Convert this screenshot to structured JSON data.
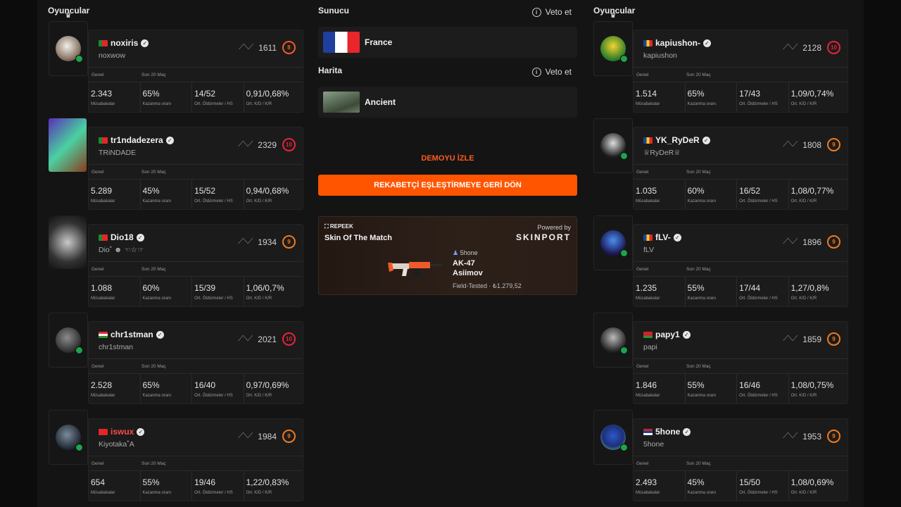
{
  "left_section_title": "Oyuncular",
  "right_section_title": "Oyuncular",
  "labels": {
    "genel": "Genel",
    "son20": "Son 20 Maç",
    "matches": "Müsabakalar",
    "winrate": "Kazanma oranı",
    "kills_hs": "Ort. Öldürmeler / HS",
    "kd_kr": "Ort. K/D / K/R"
  },
  "server": {
    "title": "Sunucu",
    "veto": "Veto et",
    "value": "France"
  },
  "map": {
    "title": "Harita",
    "veto": "Veto et",
    "value": "Ancient"
  },
  "demo_label": "DEMOYU İZLE",
  "back_button": "REKABETÇİ EŞLEŞTİRMEYE GERİ DÖN",
  "ad": {
    "brand": "REPEEK",
    "title": "Skin Of The Match",
    "powered": "Powered by",
    "sponsor": "SKINPORT",
    "seller": "5hone",
    "weapon_line1": "AK-47",
    "weapon_line2": "Asiimov",
    "condition": "Field-Tested · ₺1.279,52"
  },
  "team_left": [
    {
      "nick": "noxiris",
      "sub": "noxwow",
      "elo": "1611",
      "level": "8",
      "matches": "2.343",
      "winrate": "65%",
      "kills": "14/52",
      "kd": "0,91/0,68%",
      "flag": "portugal"
    },
    {
      "nick": "tr1ndadezera",
      "sub": "TRiNDADE",
      "elo": "2329",
      "level": "10",
      "matches": "5.289",
      "winrate": "45%",
      "kills": "15/52",
      "kd": "0,94/0,68%",
      "flag": "portugal"
    },
    {
      "nick": "Dio18",
      "sub": "Dio˚ ☻ ☜☆☞",
      "elo": "1934",
      "level": "9",
      "matches": "1.088",
      "winrate": "60%",
      "kills": "15/39",
      "kd": "1,06/0,7%",
      "flag": "portugal"
    },
    {
      "nick": "chr1stman",
      "sub": "chr1stman",
      "elo": "2021",
      "level": "10",
      "matches": "2.528",
      "winrate": "65%",
      "kills": "16/40",
      "kd": "0,97/0,69%",
      "flag": "hungary"
    },
    {
      "nick": "iswux",
      "sub": "Kiyotaka˚A",
      "elo": "1984",
      "level": "9",
      "matches": "654",
      "winrate": "55%",
      "kills": "19/46",
      "kd": "1,22/0,83%",
      "flag": "turkey"
    }
  ],
  "team_right": [
    {
      "nick": "kapiushon-",
      "sub": "kapiushon",
      "elo": "2128",
      "level": "10",
      "matches": "1.514",
      "winrate": "65%",
      "kills": "17/43",
      "kd": "1,09/0,74%",
      "flag": "romania"
    },
    {
      "nick": "YK_RyDeR",
      "sub": "♕RyDeR♕",
      "elo": "1808",
      "level": "9",
      "matches": "1.035",
      "winrate": "60%",
      "kills": "16/52",
      "kd": "1,08/0,77%",
      "flag": "romania"
    },
    {
      "nick": "fLV-",
      "sub": "fLV",
      "elo": "1896",
      "level": "9",
      "matches": "1.235",
      "winrate": "55%",
      "kills": "17/44",
      "kd": "1,27/0,8%",
      "flag": "romania"
    },
    {
      "nick": "papy1",
      "sub": "papi",
      "elo": "1859",
      "level": "9",
      "matches": "1.846",
      "winrate": "55%",
      "kills": "16/46",
      "kd": "1,08/0,75%",
      "flag": "belarus"
    },
    {
      "nick": "5hone",
      "sub": "5hone",
      "elo": "1953",
      "level": "9",
      "matches": "2.493",
      "winrate": "45%",
      "kills": "15/50",
      "kd": "1,08/0,69%",
      "flag": "serbia"
    }
  ],
  "colors": {
    "accent": "#ff5500",
    "level10": "#e6243a",
    "level9": "#ef7a1e",
    "verified": "#1fa34a"
  }
}
